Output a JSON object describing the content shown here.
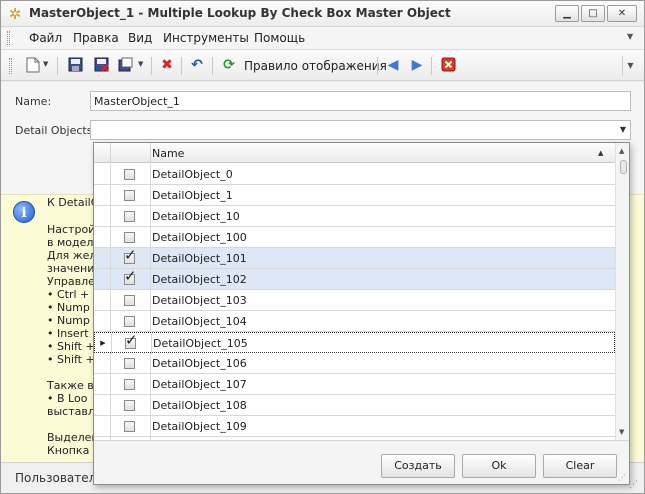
{
  "window": {
    "title": "MasterObject_1 - Multiple Lookup By Check Box Master Object",
    "minimize": "▁",
    "maximize": "□",
    "close": "✕"
  },
  "menu": {
    "items": [
      "Файл",
      "Правка",
      "Вид",
      "Инструменты",
      "Помощь"
    ]
  },
  "toolbar": {
    "refresh_label": "Правило отображения"
  },
  "form": {
    "name_label": "Name:",
    "name_value": "MasterObject_1",
    "detail_label": "Detail Objects:",
    "detail_value": ""
  },
  "info": {
    "lines": [
      "К DetailO",
      "Настрой",
      "в модели",
      "Для жела",
      "значение",
      "Управлен",
      "•  Ctrl +",
      "•  Nump",
      "•  Nump",
      "•  Insert",
      "•  Shift +",
      "•  Shift +",
      "",
      "Также вы",
      "•  В Loo",
      "выставл",
      "",
      "Выделен",
      "Кнопка О"
    ]
  },
  "status": {
    "text": "Пользователь"
  },
  "lookup": {
    "column_name": "Name",
    "rows": [
      {
        "name": "DetailObject_0",
        "checked": false,
        "selected": false,
        "focused": false
      },
      {
        "name": "DetailObject_1",
        "checked": false,
        "selected": false,
        "focused": false
      },
      {
        "name": "DetailObject_10",
        "checked": false,
        "selected": false,
        "focused": false
      },
      {
        "name": "DetailObject_100",
        "checked": false,
        "selected": false,
        "focused": false
      },
      {
        "name": "DetailObject_101",
        "checked": true,
        "selected": true,
        "focused": false
      },
      {
        "name": "DetailObject_102",
        "checked": true,
        "selected": true,
        "focused": false
      },
      {
        "name": "DetailObject_103",
        "checked": false,
        "selected": false,
        "focused": false
      },
      {
        "name": "DetailObject_104",
        "checked": false,
        "selected": false,
        "focused": false
      },
      {
        "name": "DetailObject_105",
        "checked": true,
        "selected": false,
        "focused": true
      },
      {
        "name": "DetailObject_106",
        "checked": false,
        "selected": false,
        "focused": false
      },
      {
        "name": "DetailObject_107",
        "checked": false,
        "selected": false,
        "focused": false
      },
      {
        "name": "DetailObject_108",
        "checked": false,
        "selected": false,
        "focused": false
      },
      {
        "name": "DetailObject_109",
        "checked": false,
        "selected": false,
        "focused": false
      },
      {
        "name": "",
        "checked": false,
        "selected": false,
        "focused": false
      }
    ],
    "buttons": {
      "create": "Создать",
      "ok": "Ok",
      "clear": "Clear"
    }
  }
}
